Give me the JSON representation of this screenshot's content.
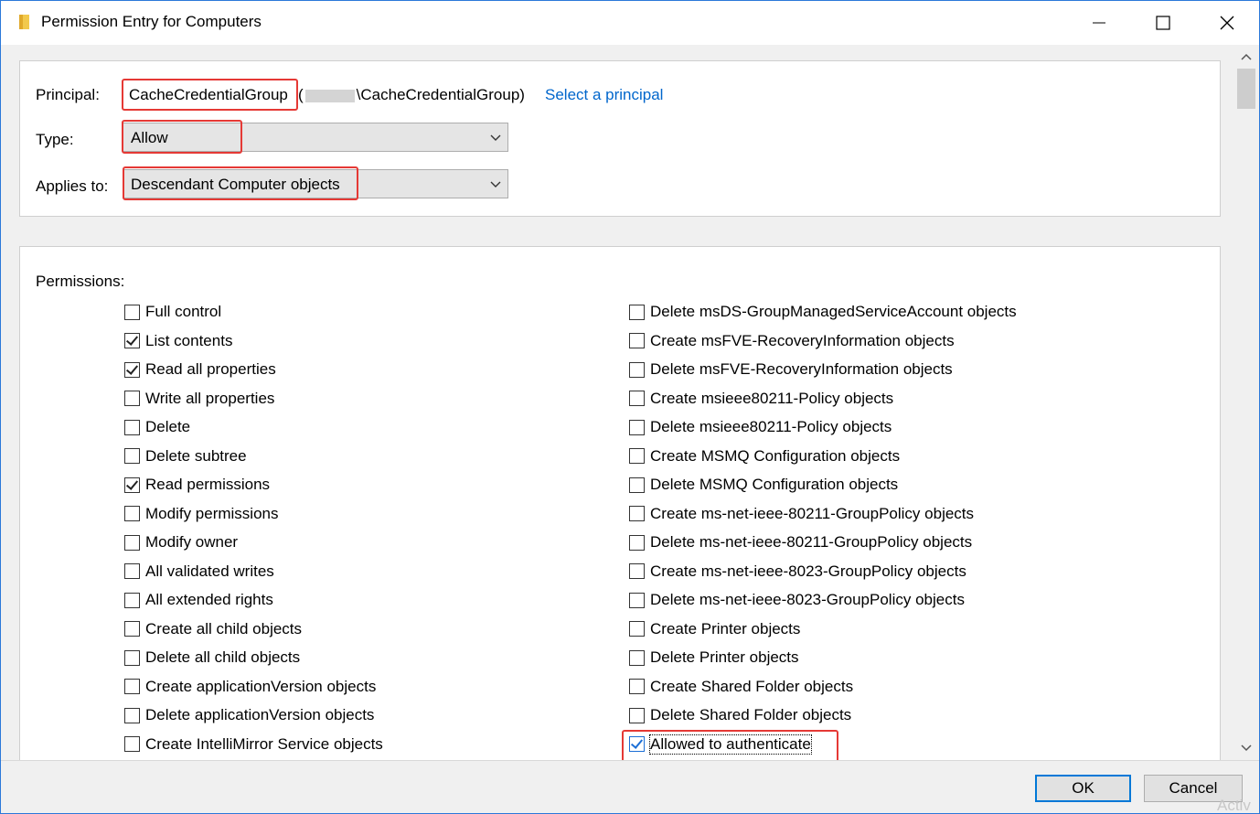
{
  "window": {
    "title": "Permission Entry for Computers",
    "minimize_icon": "minimize-icon",
    "maximize_icon": "maximize-icon",
    "close_icon": "close-icon"
  },
  "principal": {
    "label": "Principal:",
    "name": "CacheCredentialGroup",
    "full_prefix": "(",
    "full_suffix": "\\CacheCredentialGroup)",
    "select_link": "Select a principal"
  },
  "type": {
    "label": "Type:",
    "value": "Allow"
  },
  "applies_to": {
    "label": "Applies to:",
    "value": "Descendant Computer objects"
  },
  "permissions": {
    "label": "Permissions:",
    "left": [
      {
        "label": "Full control",
        "checked": false
      },
      {
        "label": "List contents",
        "checked": true
      },
      {
        "label": "Read all properties",
        "checked": true
      },
      {
        "label": "Write all properties",
        "checked": false
      },
      {
        "label": "Delete",
        "checked": false
      },
      {
        "label": "Delete subtree",
        "checked": false
      },
      {
        "label": "Read permissions",
        "checked": true
      },
      {
        "label": "Modify permissions",
        "checked": false
      },
      {
        "label": "Modify owner",
        "checked": false
      },
      {
        "label": "All validated writes",
        "checked": false
      },
      {
        "label": "All extended rights",
        "checked": false
      },
      {
        "label": "Create all child objects",
        "checked": false
      },
      {
        "label": "Delete all child objects",
        "checked": false
      },
      {
        "label": "Create applicationVersion objects",
        "checked": false
      },
      {
        "label": "Delete applicationVersion objects",
        "checked": false
      },
      {
        "label": "Create IntelliMirror Service objects",
        "checked": false
      }
    ],
    "right": [
      {
        "label": "Delete msDS-GroupManagedServiceAccount objects",
        "checked": false
      },
      {
        "label": "Create msFVE-RecoveryInformation objects",
        "checked": false
      },
      {
        "label": "Delete msFVE-RecoveryInformation objects",
        "checked": false
      },
      {
        "label": "Create msieee80211-Policy objects",
        "checked": false
      },
      {
        "label": "Delete msieee80211-Policy objects",
        "checked": false
      },
      {
        "label": "Create MSMQ Configuration objects",
        "checked": false
      },
      {
        "label": "Delete MSMQ Configuration objects",
        "checked": false
      },
      {
        "label": "Create ms-net-ieee-80211-GroupPolicy objects",
        "checked": false
      },
      {
        "label": "Delete ms-net-ieee-80211-GroupPolicy objects",
        "checked": false
      },
      {
        "label": "Create ms-net-ieee-8023-GroupPolicy objects",
        "checked": false
      },
      {
        "label": "Delete ms-net-ieee-8023-GroupPolicy objects",
        "checked": false
      },
      {
        "label": "Create Printer objects",
        "checked": false
      },
      {
        "label": "Delete Printer objects",
        "checked": false
      },
      {
        "label": "Create Shared Folder objects",
        "checked": false
      },
      {
        "label": "Delete Shared Folder objects",
        "checked": false
      },
      {
        "label": "Allowed to authenticate",
        "checked": true
      }
    ]
  },
  "buttons": {
    "ok": "OK",
    "cancel": "Cancel"
  },
  "watermark": "Activ",
  "colors": {
    "accent": "#0078d7",
    "highlight": "#e53935",
    "link": "#0066cc"
  }
}
